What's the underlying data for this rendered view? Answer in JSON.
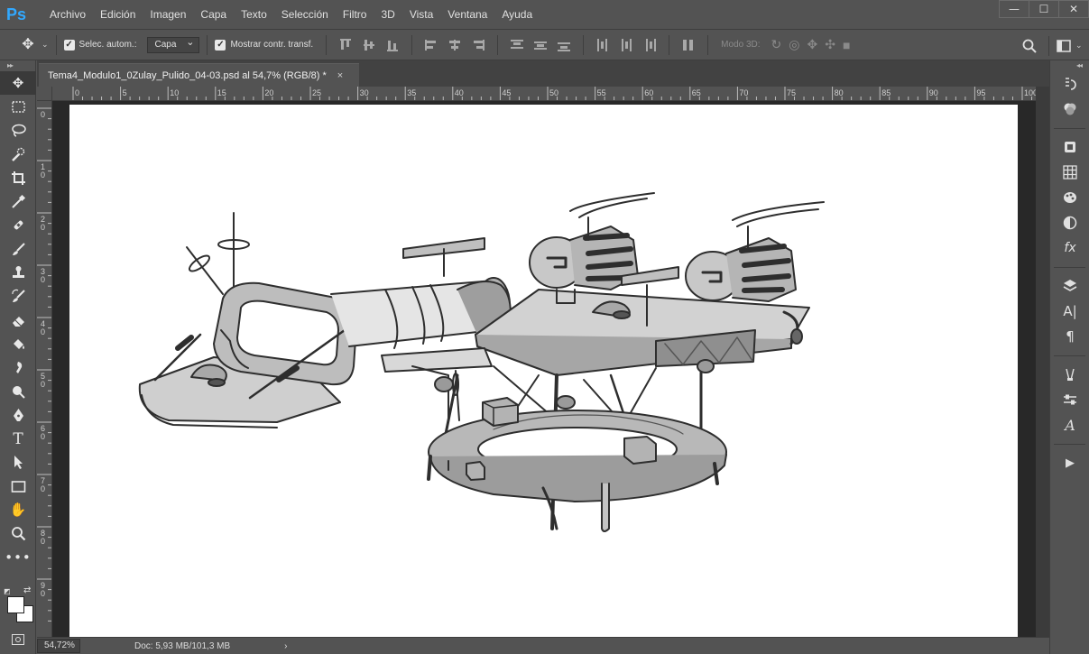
{
  "app": {
    "logo": "Ps",
    "menu": [
      "Archivo",
      "Edición",
      "Imagen",
      "Capa",
      "Texto",
      "Selección",
      "Filtro",
      "3D",
      "Vista",
      "Ventana",
      "Ayuda"
    ],
    "window_controls": [
      "—",
      "☐",
      "✕"
    ]
  },
  "options": {
    "auto_select_label": "Selec. autom.:",
    "auto_select_value": "Capa",
    "show_transform_label": "Mostrar contr. transf.",
    "mode3d_label": "Modo 3D:"
  },
  "document": {
    "tab_title": "Tema4_Modulo1_0Zulay_Pulido_04-03.psd al 54,7% (RGB/8) *",
    "tab_close": "×"
  },
  "rulers": {
    "horizontal": [
      "0",
      "5",
      "10",
      "15",
      "20",
      "25",
      "30",
      "35",
      "40",
      "45",
      "50",
      "55",
      "60",
      "65",
      "70",
      "75",
      "80",
      "85",
      "90",
      "95",
      "100"
    ],
    "vertical": [
      "0",
      "10",
      "20",
      "30",
      "40",
      "50",
      "60",
      "70",
      "80",
      "90"
    ]
  },
  "status": {
    "zoom": "54,72%",
    "doc_info": "Doc: 5,93 MB/101,3 MB",
    "arrow": "›"
  },
  "tools": [
    "move-tool",
    "marquee-tool",
    "lasso-tool",
    "quick-select-tool",
    "crop-tool",
    "eyedropper-tool",
    "healing-tool",
    "brush-tool",
    "stamp-tool",
    "history-brush-tool",
    "eraser-tool",
    "paint-bucket-tool",
    "smudge-tool",
    "dodge-tool",
    "pen-tool",
    "type-tool",
    "path-select-tool",
    "rectangle-tool",
    "hand-tool",
    "zoom-tool",
    "more-tools"
  ],
  "colors": {
    "foreground": "#ffffff",
    "background": "#ffffff",
    "accent": "#31a8ff"
  }
}
